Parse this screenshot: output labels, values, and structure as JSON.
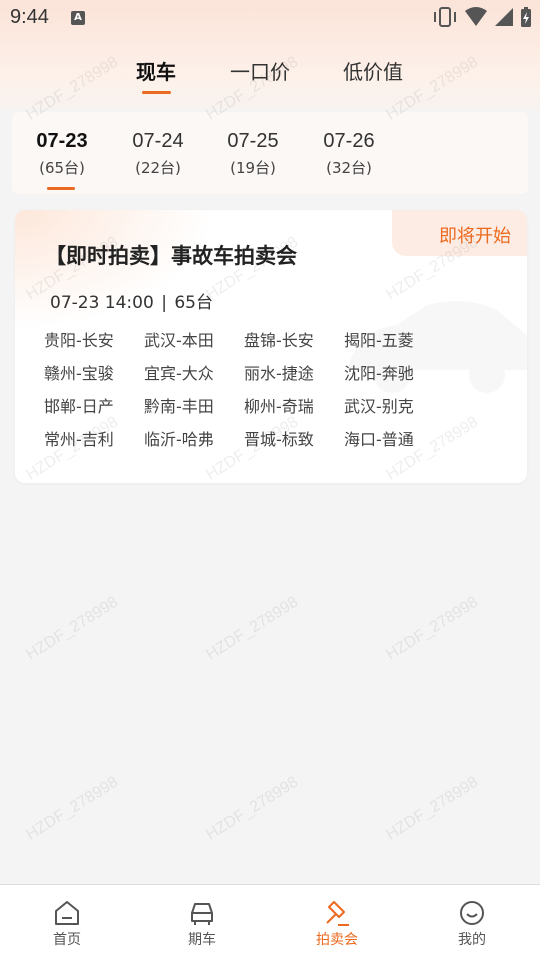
{
  "status_bar": {
    "time": "9:44",
    "notification_letter": "A"
  },
  "top_tabs": [
    {
      "label": "现车",
      "active": true
    },
    {
      "label": "一口价",
      "active": false
    },
    {
      "label": "低价值",
      "active": false
    }
  ],
  "dates": [
    {
      "day": "07-23",
      "count": "(65台)",
      "active": true
    },
    {
      "day": "07-24",
      "count": "(22台)",
      "active": false
    },
    {
      "day": "07-25",
      "count": "(19台)",
      "active": false
    },
    {
      "day": "07-26",
      "count": "(32台)",
      "active": false
    }
  ],
  "auction": {
    "status": "即将开始",
    "title": "【即时拍卖】事故车拍卖会",
    "time": "07-23 14:00",
    "separator": "|",
    "count": "65台",
    "brands": [
      "贵阳-长安",
      "武汉-本田",
      "盘锦-长安",
      "揭阳-五菱",
      "赣州-宝骏",
      "宜宾-大众",
      "丽水-捷途",
      "沈阳-奔驰",
      "邯郸-日产",
      "黔南-丰田",
      "柳州-奇瑞",
      "武汉-别克",
      "常州-吉利",
      "临沂-哈弗",
      "晋城-标致",
      "海口-普通"
    ]
  },
  "watermark": "HZDF_278998",
  "bottom_nav": [
    {
      "label": "首页",
      "icon": "home-icon",
      "active": false
    },
    {
      "label": "期车",
      "icon": "car-icon",
      "active": false
    },
    {
      "label": "拍卖会",
      "icon": "auction-hammer-icon",
      "active": true
    },
    {
      "label": "我的",
      "icon": "smile-icon",
      "active": false
    }
  ],
  "colors": {
    "accent": "#ec6a1f",
    "background": "#f4f4f4",
    "card": "#ffffff"
  }
}
